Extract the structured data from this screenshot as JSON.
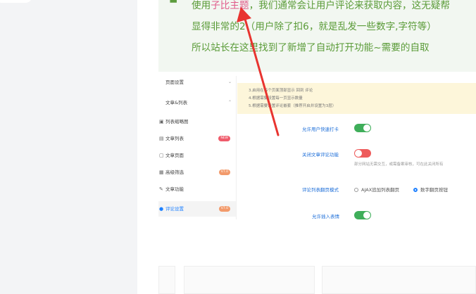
{
  "quote": {
    "line1_prefix": "使用",
    "line1_link": "子比主题",
    "line1_suffix": "，我们通常会让用户评论来获取内容，这无疑帮",
    "line2": "显得非常的2（用户除了扣6，就是乱发一些数字,字符等）",
    "line3": "所以站长在这里找到了新增了自动打开功能~需要的自取"
  },
  "admin": {
    "menu": [
      {
        "label": "页面设置",
        "icon": "page-icon",
        "chev": "⌄"
      },
      {
        "label": "文章&列表",
        "icon": "list-icon",
        "chev": "⌃"
      },
      {
        "label": "列表缩略图",
        "icon": "image-icon"
      },
      {
        "label": "文章列表",
        "icon": "file-icon",
        "badge": "NEW"
      },
      {
        "label": "文章页面",
        "icon": "file-icon"
      },
      {
        "label": "高级筛选",
        "icon": "filter-icon",
        "badge": "V7.0"
      },
      {
        "label": "文章功能",
        "icon": "pen-icon"
      },
      {
        "label": "评论设置",
        "icon": "comment-icon",
        "badge": "V7.0",
        "active": true
      }
    ],
    "notice": [
      "3.启用在每个页面顶部显示 回到 评论",
      "4.根据需要设置每一页显示数量",
      "5.根据需要设置评论嵌套（推荐开启并设置为3层）"
    ],
    "settings": {
      "quick_reply_label": "允许用户快速打卡",
      "close_comment_label": "关闭文章评论功能",
      "close_comment_desc": "部分网站无需交互，或需备案审核，可在此关闭所有",
      "pagination_label": "评论列表翻页模式",
      "pagination_option_ajax": "AJAX追加列表翻页",
      "pagination_option_number": "数字翻页按钮",
      "emoji_label": "允许插入表情"
    }
  },
  "colors": {
    "quote_text": "#5a9b38",
    "quote_link": "#e05a8a",
    "toggle_on": "#3fae5a",
    "toggle_off": "#ee5b5b",
    "arrow": "#e8342f",
    "accent": "#1e80ff"
  }
}
